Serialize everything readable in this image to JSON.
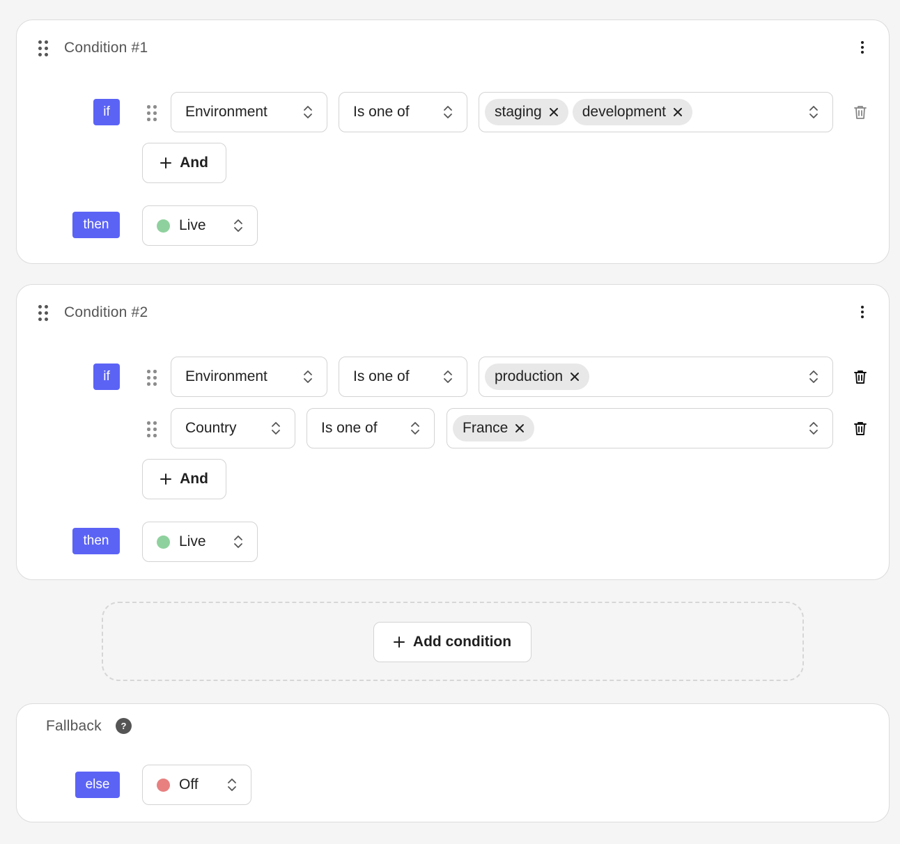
{
  "conditions": [
    {
      "title": "Condition #1",
      "if_label": "if",
      "then_label": "then",
      "rules": [
        {
          "attribute": "Environment",
          "operator": "Is one of",
          "values": [
            "staging",
            "development"
          ]
        }
      ],
      "and_label": "And",
      "result": "Live",
      "result_color": "#8fd19e"
    },
    {
      "title": "Condition #2",
      "if_label": "if",
      "then_label": "then",
      "rules": [
        {
          "attribute": "Environment",
          "operator": "Is one of",
          "values": [
            "production"
          ]
        },
        {
          "attribute": "Country",
          "operator": "Is one of",
          "values": [
            "France"
          ]
        }
      ],
      "and_label": "And",
      "result": "Live",
      "result_color": "#8fd19e"
    }
  ],
  "add_condition_label": "Add condition",
  "fallback": {
    "title": "Fallback",
    "help_glyph": "?",
    "else_label": "else",
    "result": "Off",
    "result_color": "#e88080"
  },
  "colors": {
    "accent": "#5b63f5",
    "background": "#f5f5f5",
    "live": "#8fd19e",
    "off": "#e88080"
  }
}
